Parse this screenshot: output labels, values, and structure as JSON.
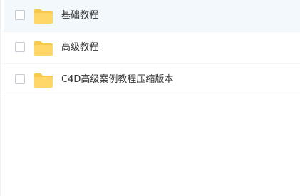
{
  "colors": {
    "folder": "#ffd768",
    "folder_tab": "#f7c84b",
    "hover_row": "#f3f8fd",
    "text": "#333333"
  },
  "files": [
    {
      "name": "基础教程",
      "icon": "folder-icon",
      "hovered": true
    },
    {
      "name": "高级教程",
      "icon": "folder-icon",
      "hovered": false
    },
    {
      "name": "C4D高级案例教程压缩版本",
      "icon": "folder-icon",
      "hovered": false
    }
  ]
}
